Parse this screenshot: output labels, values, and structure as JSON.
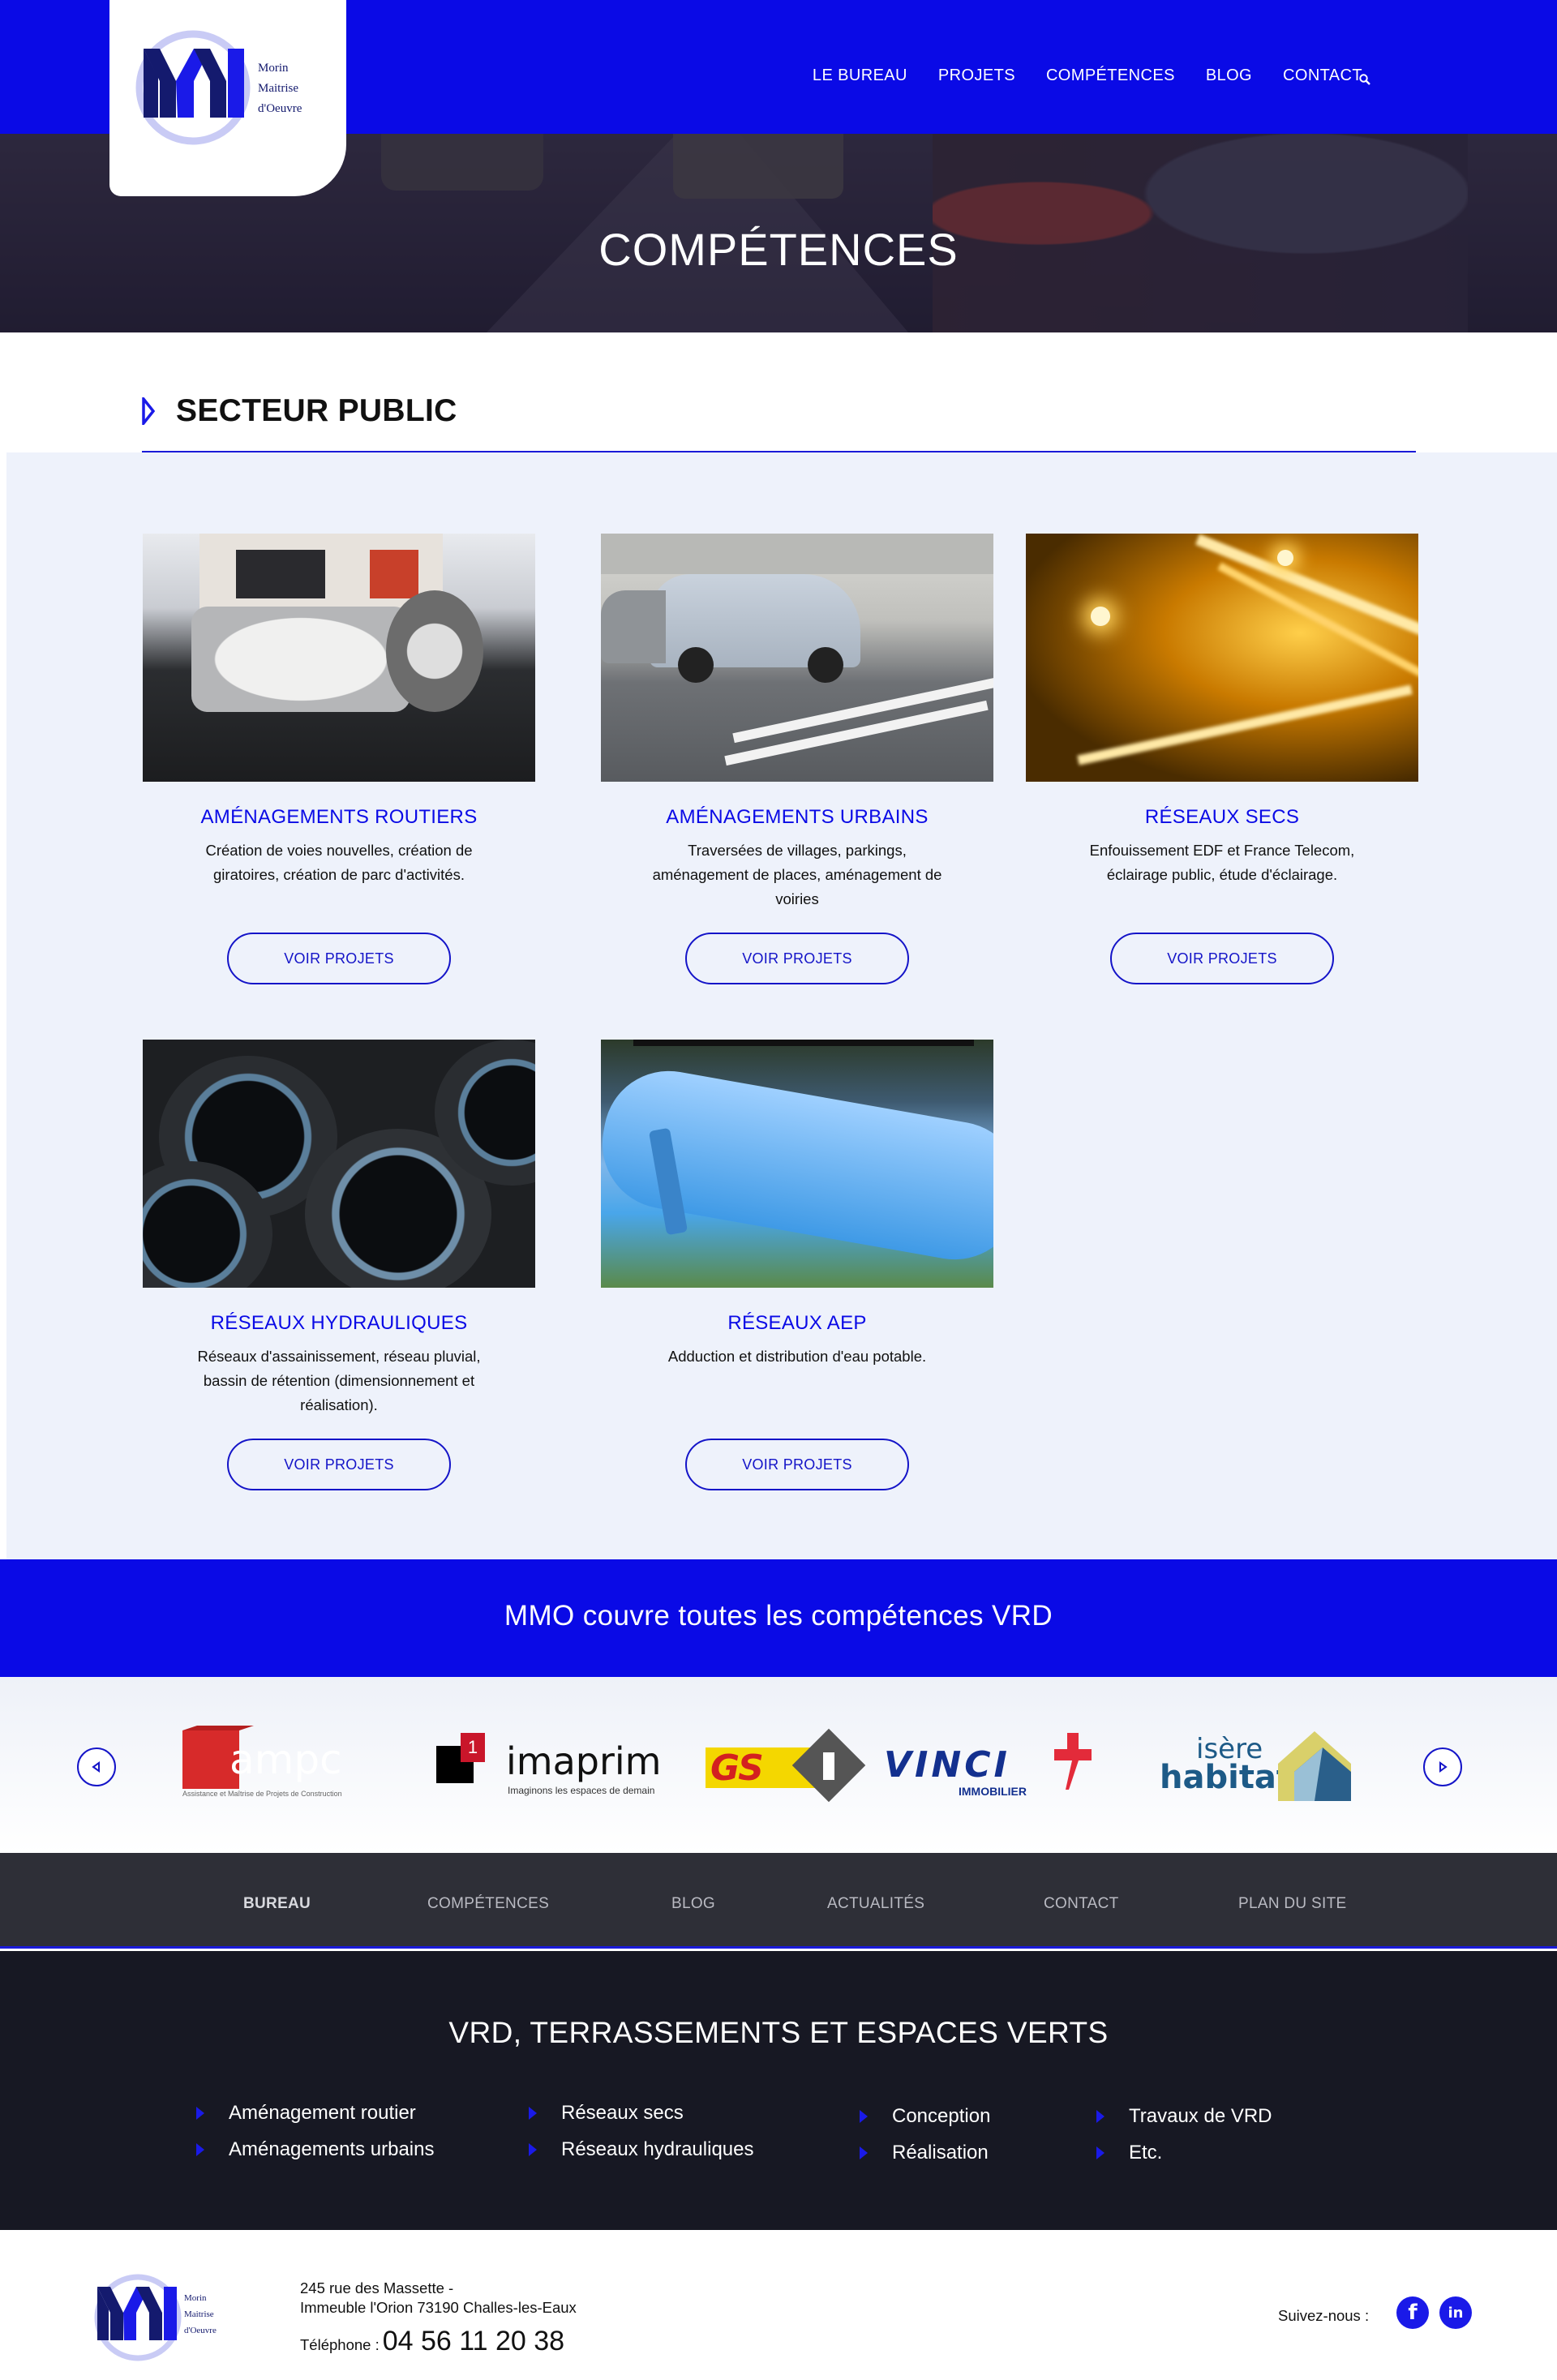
{
  "brand": {
    "logo_line1": "Morin",
    "logo_line2": "Maitrise",
    "logo_line3": "d'Oeuvre",
    "accent": "#0a0ae6"
  },
  "nav": {
    "items": [
      "LE BUREAU",
      "PROJETS",
      "COMPÉTENCES",
      "BLOG",
      "CONTACT"
    ],
    "search_icon": "search-icon"
  },
  "hero": {
    "title": "COMPÉTENCES"
  },
  "section": {
    "title": "SECTEUR PUBLIC"
  },
  "cards": [
    {
      "title": "AMÉNAGEMENTS ROUTIERS",
      "text": "Création de voies nouvelles, création de giratoires, création de parc d'activités.",
      "button": "VOIR PROJETS"
    },
    {
      "title": "AMÉNAGEMENTS URBAINS",
      "text": "Traversées de villages, parkings, aménagement de places, aménagement de voiries",
      "button": "VOIR PROJETS"
    },
    {
      "title": "RÉSEAUX SECS",
      "text": "Enfouissement EDF et France Telecom, éclairage public, étude d'éclairage.",
      "button": "VOIR PROJETS"
    },
    {
      "title": "RÉSEAUX HYDRAULIQUES",
      "text": "Réseaux d'assainissement, réseau pluvial, bassin de rétention (dimensionnement et réalisation).",
      "button": "VOIR PROJETS"
    },
    {
      "title": "RÉSEAUX AEP",
      "text": "Adduction et distribution d'eau potable.",
      "button": "VOIR PROJETS"
    }
  ],
  "banner": {
    "text": "MMO couvre toutes les compétences VRD"
  },
  "partners": {
    "ampc": {
      "name": "ampc",
      "tagline": "Assistance et Maîtrise de Projets de Construction"
    },
    "imaprim": {
      "name": "imaprim",
      "badge": "1",
      "tagline": "Imaginons les espaces de demain"
    },
    "gsi": {
      "name": "GS"
    },
    "vinci": {
      "name": "VINCI",
      "sub": "IMMOBILIER"
    },
    "isere": {
      "line1": "isère",
      "line2": "habitat"
    }
  },
  "footer_nav": [
    "BUREAU",
    "COMPÉTENCES",
    "BLOG",
    "ACTUALITÉS",
    "CONTACT",
    "PLAN DU SITE"
  ],
  "dark": {
    "title": "VRD, TERRASSEMENTS ET ESPACES VERTS",
    "skills": [
      "Aménagement routier",
      "Aménagements urbains",
      "Réseaux secs",
      "Réseaux hydrauliques",
      "Conception",
      "Réalisation",
      "Travaux de VRD",
      "Etc."
    ]
  },
  "contact": {
    "address_line1": "245 rue des Massette -",
    "address_line2": "Immeuble l'Orion 73190 Challes-les-Eaux",
    "phone_label": "Téléphone :",
    "phone": "04 56 11 20 38",
    "follow": "Suivez-nous :",
    "facebook": "f",
    "linkedin": "in"
  }
}
